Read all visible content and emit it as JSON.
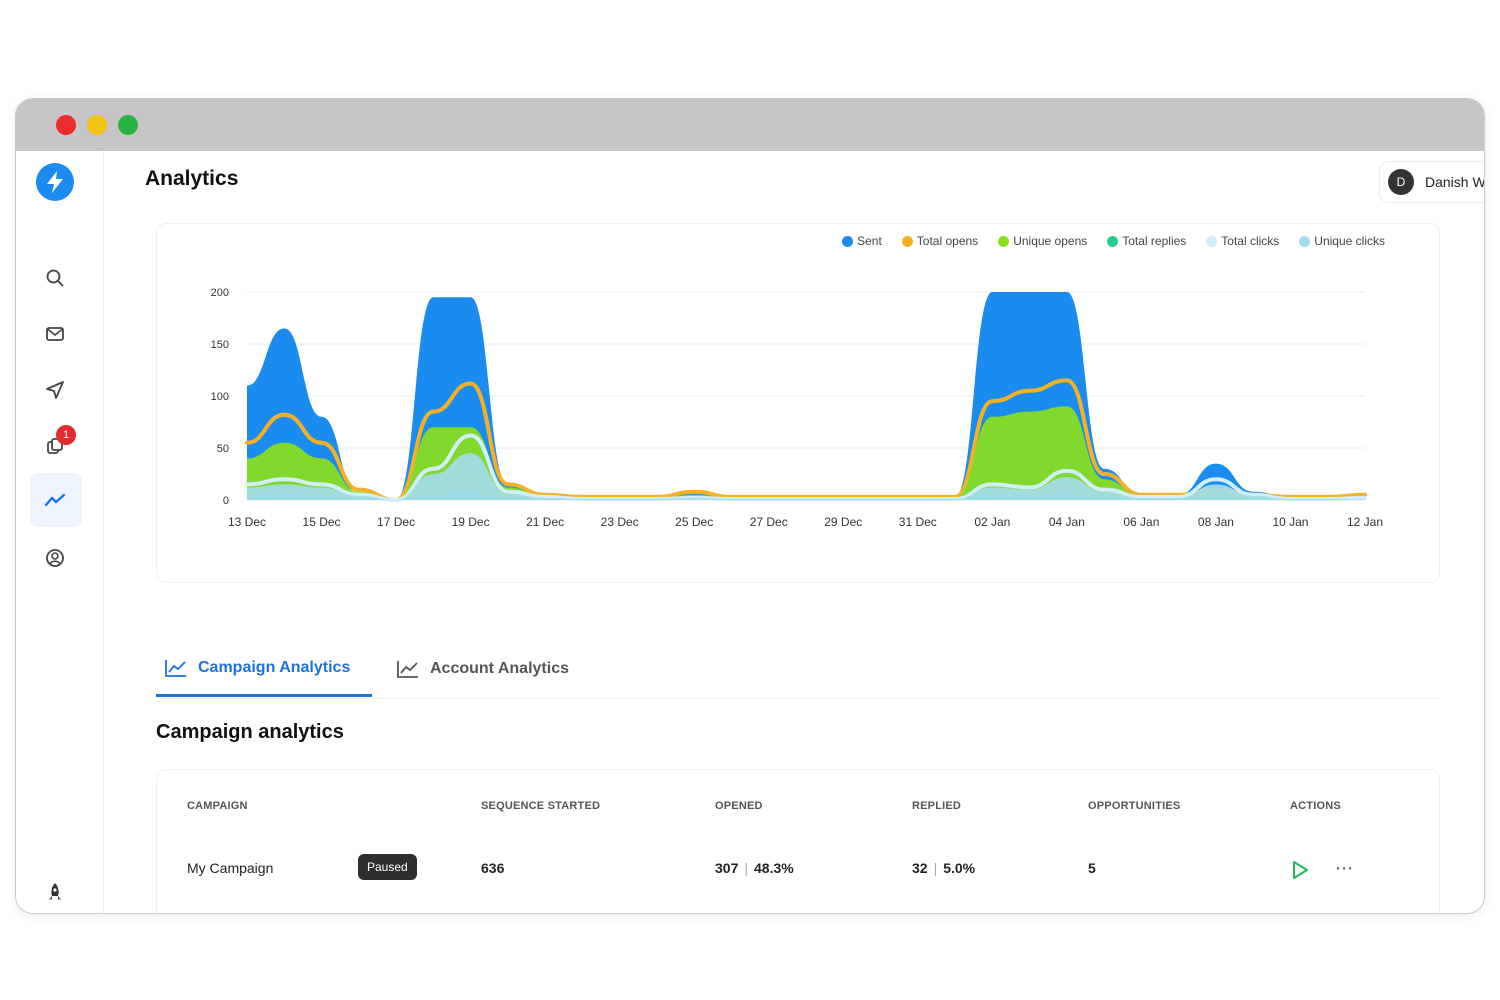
{
  "app": {
    "title": "Analytics"
  },
  "user": {
    "initial": "D",
    "name": "Danish W"
  },
  "sidebar": {
    "icons": [
      "logo-bolt-icon",
      "search-icon",
      "mail-icon",
      "send-icon",
      "copy-icon",
      "analytics-icon",
      "user-circle-icon",
      "rocket-icon"
    ],
    "badge_count": "1"
  },
  "chart_data": {
    "type": "area",
    "title": "",
    "ylim": [
      0,
      200
    ],
    "yticks": [
      "200",
      "150",
      "100",
      "50",
      "0"
    ],
    "x": [
      "13 Dec",
      "14 Dec",
      "15 Dec",
      "16 Dec",
      "17 Dec",
      "18 Dec",
      "19 Dec",
      "20 Dec",
      "21 Dec",
      "22 Dec",
      "23 Dec",
      "24 Dec",
      "25 Dec",
      "26 Dec",
      "27 Dec",
      "28 Dec",
      "29 Dec",
      "30 Dec",
      "31 Dec",
      "01 Jan",
      "02 Jan",
      "03 Jan",
      "04 Jan",
      "05 Jan",
      "06 Jan",
      "07 Jan",
      "08 Jan",
      "09 Jan",
      "10 Jan",
      "11 Jan",
      "12 Jan"
    ],
    "xticks": [
      "13 Dec",
      "15 Dec",
      "17 Dec",
      "19 Dec",
      "21 Dec",
      "23 Dec",
      "25 Dec",
      "27 Dec",
      "29 Dec",
      "31 Dec",
      "02 Jan",
      "04 Jan",
      "06 Jan",
      "08 Jan",
      "10 Jan",
      "12 Jan"
    ],
    "legend_position": "top-right",
    "grid": true,
    "series": [
      {
        "name": "Sent",
        "color": "#1a8cf0",
        "kind": "area",
        "values": [
          110,
          165,
          80,
          5,
          0,
          195,
          195,
          15,
          5,
          3,
          3,
          3,
          8,
          3,
          3,
          3,
          3,
          3,
          3,
          3,
          200,
          200,
          200,
          30,
          5,
          5,
          35,
          8,
          3,
          3,
          5
        ]
      },
      {
        "name": "Total opens",
        "color": "#f5b025",
        "kind": "line",
        "values": [
          55,
          82,
          55,
          10,
          0,
          85,
          112,
          15,
          5,
          3,
          3,
          3,
          8,
          3,
          3,
          3,
          3,
          3,
          3,
          3,
          95,
          105,
          115,
          25,
          5,
          5,
          10,
          5,
          3,
          3,
          5
        ]
      },
      {
        "name": "Unique opens",
        "color": "#8be01d",
        "kind": "area",
        "values": [
          40,
          55,
          40,
          8,
          0,
          70,
          70,
          12,
          4,
          2,
          2,
          2,
          5,
          2,
          2,
          2,
          2,
          2,
          2,
          2,
          80,
          85,
          90,
          20,
          4,
          4,
          8,
          4,
          2,
          2,
          3
        ]
      },
      {
        "name": "Total replies",
        "color": "#21d08a",
        "kind": "area",
        "values": [
          5,
          6,
          5,
          1,
          0,
          5,
          8,
          2,
          1,
          1,
          1,
          1,
          1,
          1,
          1,
          1,
          1,
          1,
          1,
          1,
          6,
          5,
          6,
          3,
          1,
          1,
          3,
          1,
          1,
          1,
          1
        ]
      },
      {
        "name": "Total clicks",
        "color": "#d2eefa",
        "kind": "line",
        "values": [
          15,
          20,
          15,
          5,
          0,
          30,
          62,
          8,
          3,
          1,
          1,
          1,
          2,
          1,
          1,
          1,
          1,
          1,
          1,
          1,
          15,
          12,
          28,
          10,
          3,
          3,
          20,
          5,
          1,
          1,
          2
        ]
      },
      {
        "name": "Unique clicks",
        "color": "#a3dcec",
        "kind": "area",
        "values": [
          12,
          15,
          12,
          4,
          0,
          25,
          45,
          6,
          2,
          1,
          1,
          1,
          2,
          1,
          1,
          1,
          1,
          1,
          1,
          1,
          12,
          10,
          22,
          8,
          2,
          2,
          15,
          4,
          1,
          1,
          1
        ]
      }
    ]
  },
  "tabs": [
    {
      "label": "Campaign Analytics",
      "icon": "line-chart-icon",
      "active": true
    },
    {
      "label": "Account Analytics",
      "icon": "line-chart-icon",
      "active": false
    }
  ],
  "section": {
    "title": "Campaign analytics"
  },
  "table": {
    "headers": {
      "campaign": "CAMPAIGN",
      "sequence": "SEQUENCE STARTED",
      "opened": "OPENED",
      "replied": "REPLIED",
      "opportunities": "OPPORTUNITIES",
      "actions": "ACTIONS"
    },
    "rows": [
      {
        "name": "My Campaign",
        "status": "Paused",
        "sequence_started": "636",
        "opened_count": "307",
        "opened_pct": "48.3%",
        "replied_count": "32",
        "replied_pct": "5.0%",
        "opportunities": "5"
      }
    ]
  },
  "colors": {
    "accent": "#1d72e0",
    "badge": "#e22b2b"
  }
}
